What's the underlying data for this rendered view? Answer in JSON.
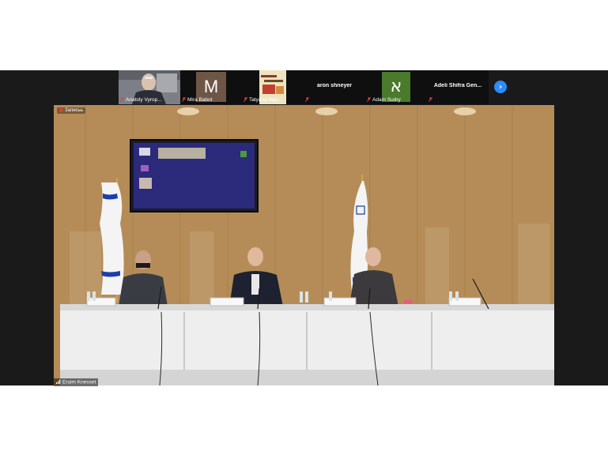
{
  "participants": [
    {
      "name": "Anatoly Vyrop...",
      "muted": true,
      "video": true
    },
    {
      "name": "Mira Babot",
      "muted": true,
      "initial": "M",
      "avatar_color": "#6e5647"
    },
    {
      "name": "Tatyana Man...",
      "muted": true,
      "video": true
    },
    {
      "name": "aron shneyer",
      "muted": true,
      "center_name": true
    },
    {
      "name": "Adam Sudry",
      "muted": true,
      "initial": "א",
      "avatar_color": "#4a7a2c"
    },
    {
      "name": "Adeli Shifra Gen...",
      "muted": true,
      "center_name": true
    }
  ],
  "next_arrow": "›",
  "recording_label": "Записьь",
  "active_speaker": "Eruim Knesset",
  "colors": {
    "accent": "#2d8cff",
    "muted_icon": "#e04040",
    "wall_wood": "#b28a55",
    "flag_blue": "#1d3fa8"
  },
  "icons": [
    "mic-muted-icon",
    "chevron-right-icon",
    "record-dot-icon",
    "signal-bars-icon"
  ]
}
